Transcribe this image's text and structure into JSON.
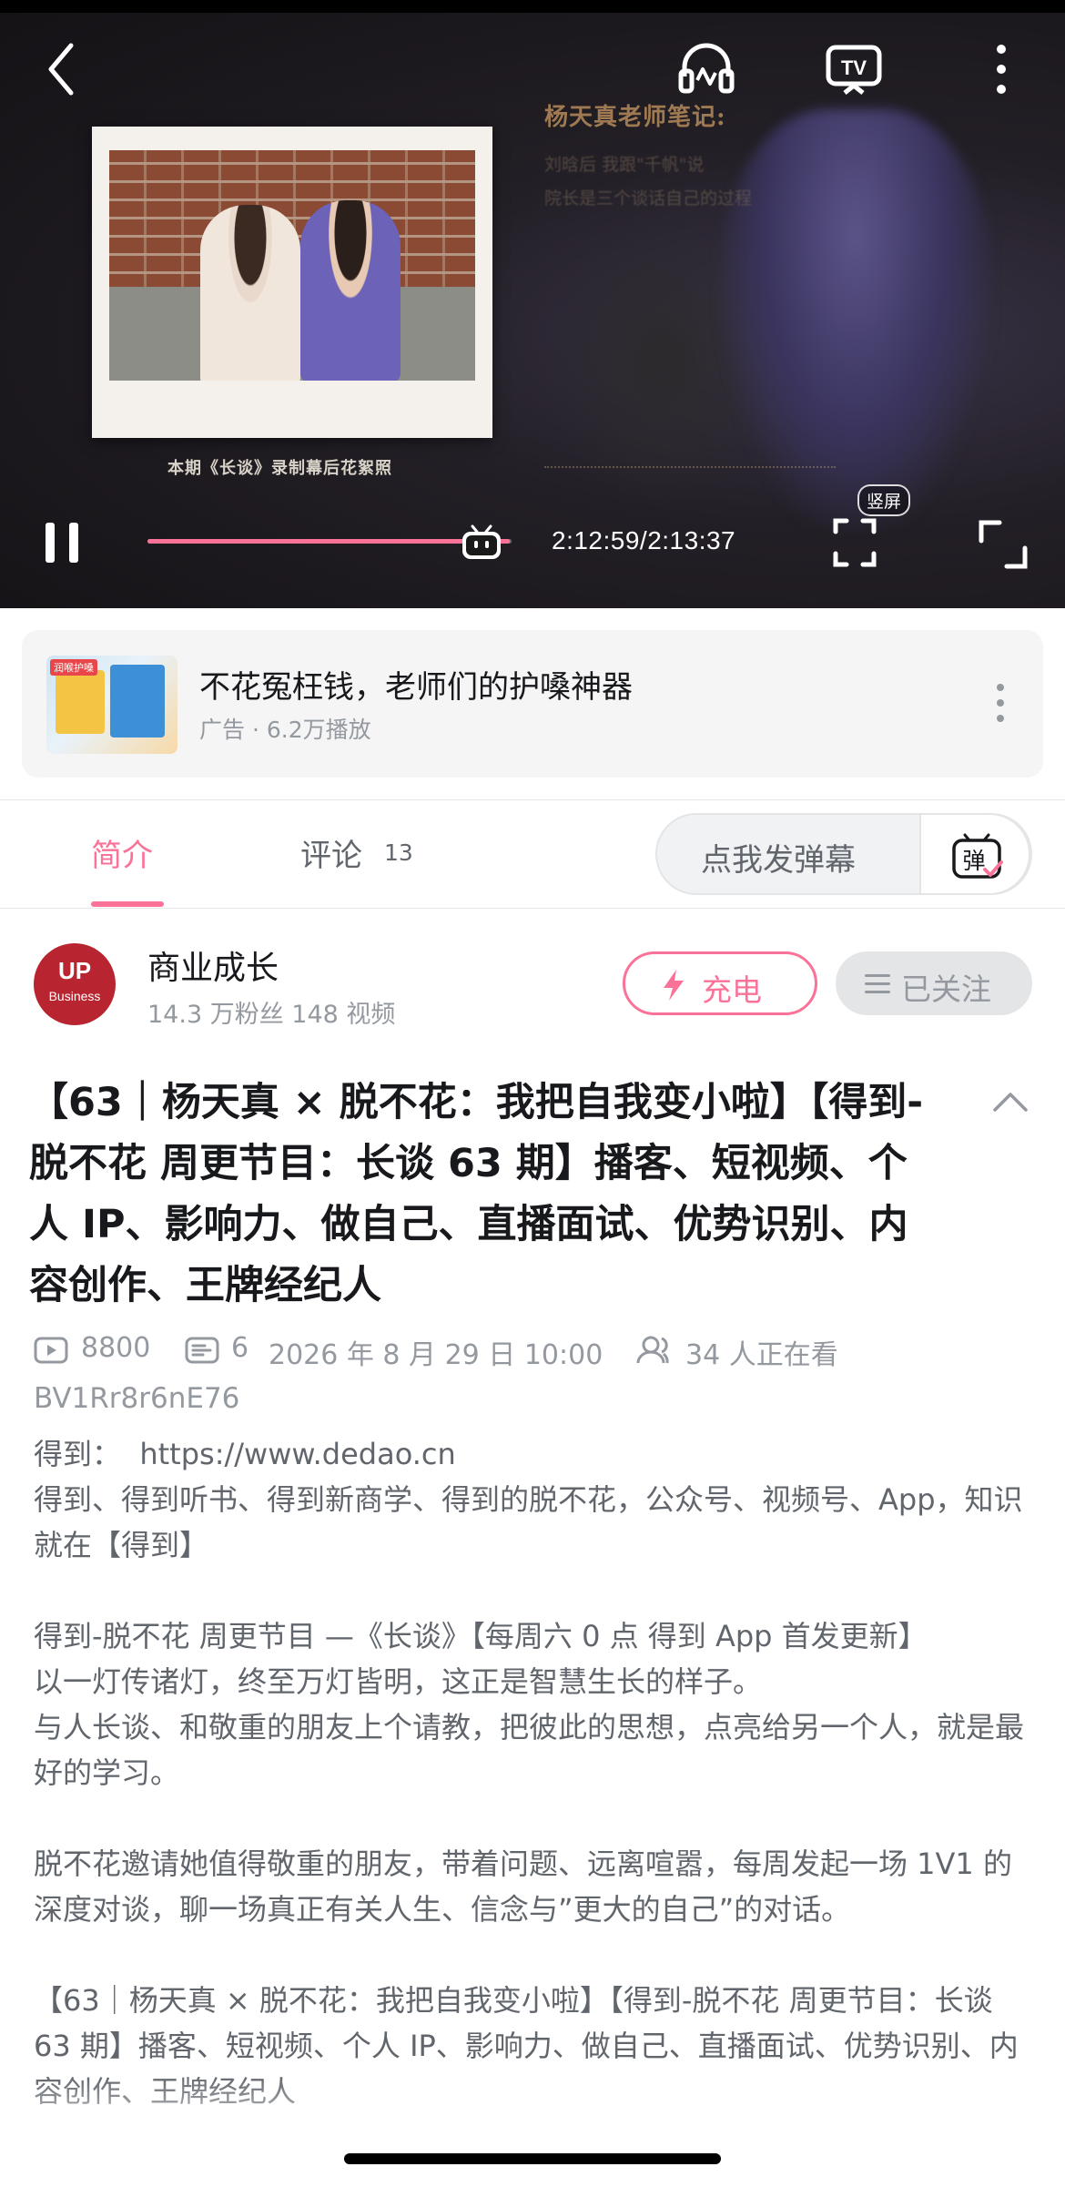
{
  "player": {
    "note_title": "杨天真老师笔记:",
    "note_lines": [
      "刘晗后 我跟\"千帆\"说",
      "院长是三个谈话自己的过程"
    ],
    "caption": "本期《长谈》录制幕后花絮照",
    "time": "2:12:59/2:13:37",
    "progress": 0.9953,
    "portrait_label": "竖屏",
    "accent": "#fb7299"
  },
  "ad": {
    "title": "不花冤枉钱，老师们的护嗓神器",
    "sub": "广告 · 6.2万播放",
    "thumb_tag": "润喉护嗓"
  },
  "tabs": {
    "intro": "简介",
    "comments": "评论",
    "comments_count": "13",
    "danmaku_placeholder": "点我发弹幕",
    "danmaku_icon": "弹"
  },
  "uploader": {
    "avatar_top": "UP",
    "avatar_bottom": "Business",
    "name": "商业成长",
    "stats": "14.3 万粉丝   148 视频",
    "charge_label": "充电",
    "follow_label": "已关注"
  },
  "video": {
    "title": "【63｜杨天真 × 脱不花：我把自我变小啦】【得到-脱不花 周更节目：长谈 63 期】播客、短视频、个人 IP、影响力、做自己、直播面试、优势识别、内容创作、王牌经纪人",
    "views": "8800",
    "danmaku_count": "6",
    "date": "2026 年 8 月 29 日 10:00",
    "watching": "34 人正在看",
    "bvid": "BV1Rr8r6nE76"
  },
  "description": [
    "得到：  https://www.dedao.cn",
    "得到、得到听书、得到新商学、得到的脱不花，公众号、视频号、App，知识 就在【得到】",
    "",
    "得到-脱不花 周更节目 —《长谈》【每周六 0 点 得到 App 首发更新】",
    "以一灯传诸灯，终至万灯皆明，这正是智慧生长的样子。",
    "与人长谈、和敬重的朋友上个请教，把彼此的思想，点亮给另一个人，就是最好的学习。",
    "",
    "脱不花邀请她值得敬重的朋友，带着问题、远离喧嚣，每周发起一场 1V1 的深度对谈，聊一场真正有关人生、信念与”更大的自己”的对话。",
    "",
    "【63｜杨天真 × 脱不花：我把自我变小啦】【得到-脱不花 周更节目：长谈 63 期】播客、短视频、个人 IP、影响力、做自己、直播面试、优势识别、内容创作、王牌经纪人"
  ]
}
